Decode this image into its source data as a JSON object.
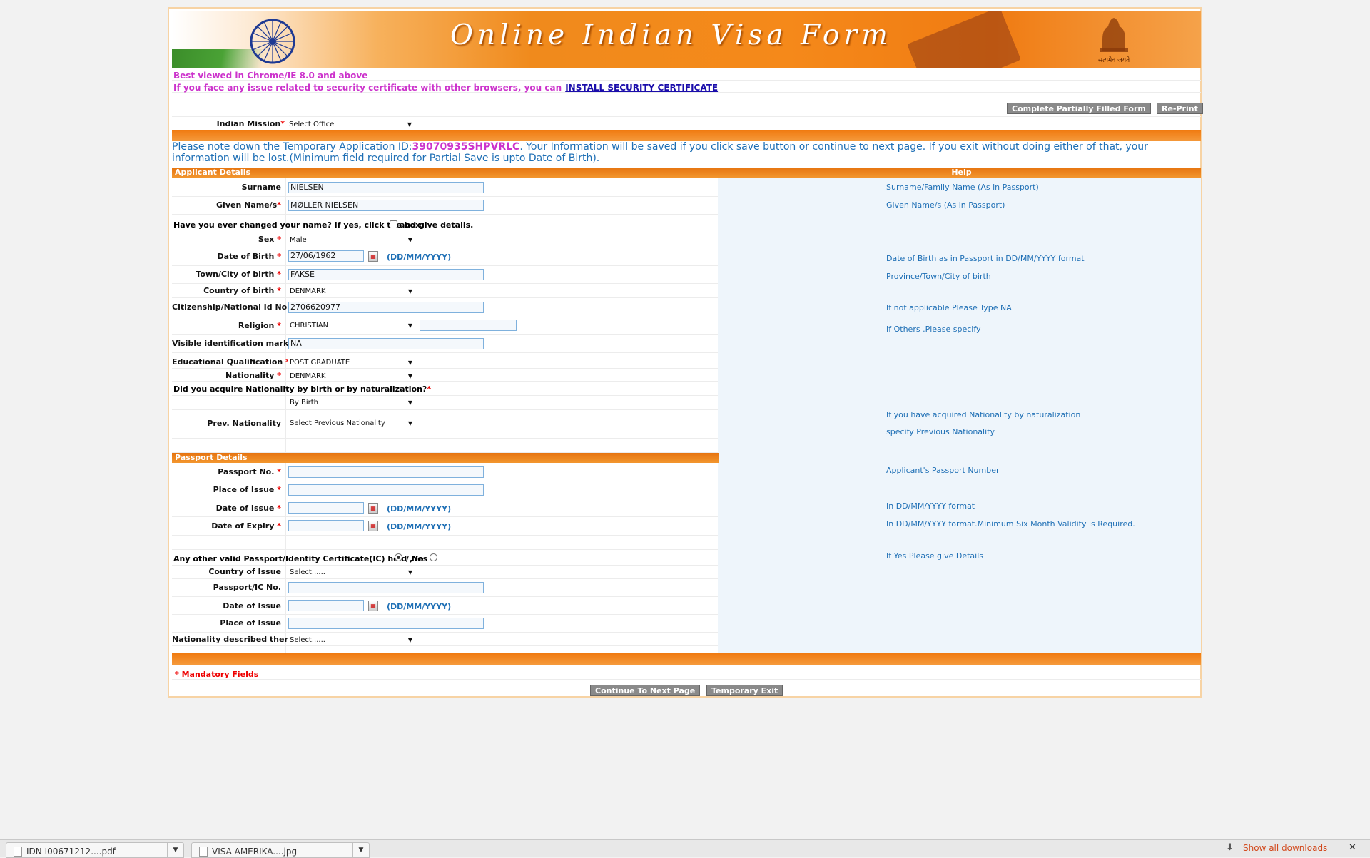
{
  "banner": {
    "title": "Online Indian Visa Form",
    "motto": "सत्यमेव जयते"
  },
  "notices": {
    "browser": "Best viewed in Chrome/IE 8.0 and above",
    "cert_text": "If you face any issue related to security certificate with other browsers, you can",
    "cert_link": "INSTALL SECURITY CERTIFICATE"
  },
  "top_buttons": {
    "complete": "Complete Partially Filled Form",
    "reprint": "Re-Print"
  },
  "mission": {
    "label": "Indian Mission",
    "value": "Select Office"
  },
  "temp_note": {
    "prefix": "Please note down the Temporary Application ID:",
    "app_id": "39070935SHPVRLC",
    "suffix": ". Your Information will be saved if you click save button or continue to next page. If you exit without doing either of that, your information will be lost.(Minimum field required for Partial Save is upto Date of Birth)."
  },
  "applicant": {
    "header": "Applicant Details",
    "help_header": "Help",
    "surname": {
      "label": "Surname",
      "value": "NIELSEN",
      "help": "Surname/Family Name (As in Passport)"
    },
    "given": {
      "label": "Given Name/s",
      "value": "MØLLER NIELSEN",
      "help": "Given Name/s (As in Passport)"
    },
    "changed_name": {
      "text_a": "Have you ever changed your name? If yes, click the box",
      "text_b": "and give details."
    },
    "sex": {
      "label": "Sex",
      "value": "Male"
    },
    "dob": {
      "label": "Date of Birth",
      "value": "27/06/1962",
      "format": "(DD/MM/YYYY)",
      "help": "Date of Birth as in Passport in DD/MM/YYYY format"
    },
    "town": {
      "label": "Town/City of birth",
      "value": "FAKSE",
      "help": "Province/Town/City of birth"
    },
    "country_birth": {
      "label": "Country of birth",
      "value": "DENMARK"
    },
    "citizenship": {
      "label": "Citizenship/National Id No.",
      "value": "2706620977",
      "help": "If not applicable Please Type NA"
    },
    "religion": {
      "label": "Religion",
      "value": "CHRISTIAN",
      "other": "",
      "help": "If Others .Please specify"
    },
    "marks": {
      "label": "Visible identification marks",
      "value": "NA"
    },
    "education": {
      "label": "Educational Qualification",
      "value": "POST GRADUATE"
    },
    "nationality": {
      "label": "Nationality",
      "value": "DENMARK"
    },
    "acquire": {
      "question": "Did you acquire Nationality by birth or by naturalization?",
      "value": "By Birth"
    },
    "prev_nat": {
      "label": "Prev. Nationality",
      "value": "Select Previous Nationality",
      "help1": "If you have acquired Nationality by naturalization",
      "help2": "specify Previous Nationality"
    }
  },
  "passport": {
    "header": "Passport Details",
    "number": {
      "label": "Passport No.",
      "value": "",
      "help": "Applicant's Passport Number"
    },
    "place": {
      "label": "Place of Issue",
      "value": ""
    },
    "issue_date": {
      "label": "Date of Issue",
      "value": "",
      "format": "(DD/MM/YYYY)",
      "help": "In DD/MM/YYYY format"
    },
    "expiry": {
      "label": "Date of Expiry",
      "value": "",
      "format": "(DD/MM/YYYY)",
      "help": "In DD/MM/YYYY format.Minimum Six Month Validity is Required."
    },
    "other": {
      "question": "Any other valid Passport/Identity Certificate(IC) held ,Yes",
      "no": "/ No",
      "help": "If Yes Please give Details"
    },
    "other_country": {
      "label": "Country of Issue",
      "value": "Select......"
    },
    "other_number": {
      "label": "Passport/IC No.",
      "value": ""
    },
    "other_date": {
      "label": "Date of Issue",
      "value": "",
      "format": "(DD/MM/YYYY)"
    },
    "other_place": {
      "label": "Place of Issue",
      "value": ""
    },
    "other_nat": {
      "label": "Nationality described therein",
      "value": "Select......"
    }
  },
  "footer": {
    "mandatory": "* Mandatory Fields",
    "continue": "Continue To Next Page",
    "exit": "Temporary Exit"
  },
  "downloads": {
    "items": [
      {
        "name": "IDN I00671212....pdf"
      },
      {
        "name": "VISA AMERIKA....jpg"
      }
    ],
    "show_all": "Show all downloads",
    "close": "✕"
  }
}
